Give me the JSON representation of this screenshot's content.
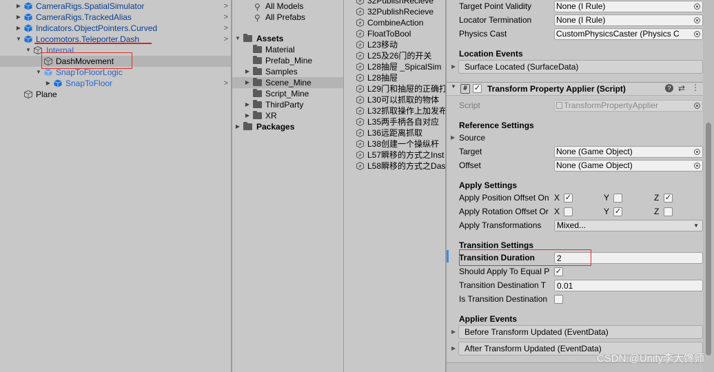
{
  "hierarchy": {
    "items": [
      {
        "label": "CameraRigs.SpatialSimulator"
      },
      {
        "label": "CameraRigs.TrackedAlias"
      },
      {
        "label": "Indicators.ObjectPointers.Curved"
      },
      {
        "label": "Locomotors.Teleporter.Dash"
      },
      {
        "label": "Internal"
      },
      {
        "label": "DashMovement"
      },
      {
        "label": "SnapToFloorLogic"
      },
      {
        "label": "SnapToFloor"
      },
      {
        "label": "Plane"
      }
    ]
  },
  "project": {
    "tree": [
      {
        "label": "All Models"
      },
      {
        "label": "All Prefabs"
      },
      {
        "label": "Assets"
      },
      {
        "label": "Material"
      },
      {
        "label": "Prefab_Mine"
      },
      {
        "label": "Samples"
      },
      {
        "label": "Scene_Mine"
      },
      {
        "label": "Script_Mine"
      },
      {
        "label": "ThirdParty"
      },
      {
        "label": "XR"
      },
      {
        "label": "Packages"
      }
    ],
    "files": [
      "32PublishRecieve",
      "32PublishRecieve",
      "CombineAction",
      "FloatToBool",
      "L23移动",
      "L25及26门的开关",
      "L28抽屉 _SpicalSim",
      "L28抽屉",
      "L29门和抽屉的正确打",
      "L30可以抓取的物体",
      "L32抓取操作上加发布",
      "L35两手柄各自对应",
      "L36远距离抓取",
      "L38创建一个操纵杆",
      "L57瞬移的方式之Inst",
      "L58瞬移的方式之Das"
    ]
  },
  "inspector": {
    "top_fields": [
      {
        "label": "Target Point Validity",
        "value": "None (I Rule)"
      },
      {
        "label": "Locator Termination",
        "value": "None (I Rule)"
      },
      {
        "label": "Physics Cast",
        "value": "CustomPhysicsCaster (Physics C"
      }
    ],
    "location_events": {
      "title": "Location Events",
      "surface_located": "Surface Located (SurfaceData)"
    },
    "component": {
      "hash": "#",
      "title": "Transform Property Applier (Script)",
      "script_label": "Script",
      "script_value": "TransformPropertyApplier"
    },
    "reference_settings": {
      "title": "Reference Settings",
      "source_label": "Source",
      "target_label": "Target",
      "target_value": "None (Game Object)",
      "offset_label": "Offset",
      "offset_value": "None (Game Object)"
    },
    "apply_settings": {
      "title": "Apply Settings",
      "position_label": "Apply Position Offset On",
      "rotation_label": "Apply Rotation Offset Or",
      "transformations_label": "Apply Transformations",
      "transformations_value": "Mixed...",
      "x_label": "X",
      "y_label": "Y",
      "z_label": "Z"
    },
    "transition_settings": {
      "title": "Transition Settings",
      "duration_label": "Transition Duration",
      "duration_value": "2",
      "should_apply_label": "Should Apply To Equal P",
      "destination_threshold_label": "Transition Destination T",
      "destination_threshold_value": "0.01",
      "is_destination_label": "Is Transition Destination"
    },
    "applier_events": {
      "title": "Applier Events",
      "before_label": "Before Transform Updated (EventData)",
      "after_label": "After Transform Updated (EventData)"
    }
  },
  "watermark": "CSDN @Unity李大馋师",
  "colors": {
    "panel_bg": "#c8c8c8",
    "selection": "#b4b4b4",
    "prefab_blue": "#0b3e8f",
    "highlight_red": "#e0302a",
    "accent_blue": "#3a8de0"
  }
}
